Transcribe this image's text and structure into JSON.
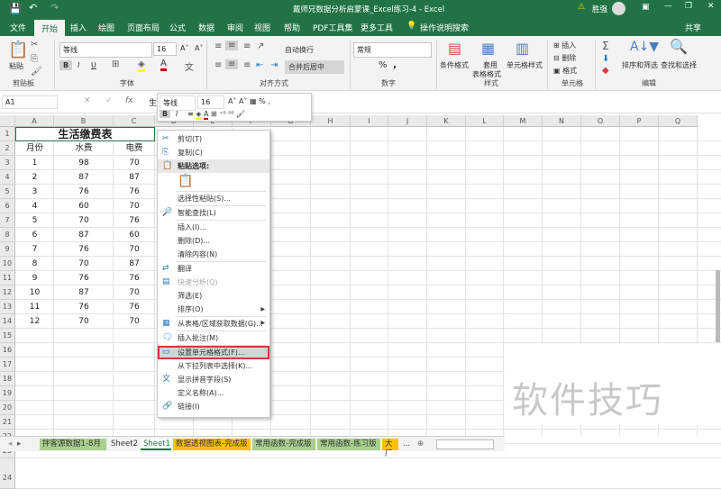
{
  "title": "戴师兄数据分析启蒙课_Excel练习-4  -  Excel",
  "user": "胜强",
  "tabs": [
    "文件",
    "开始",
    "插入",
    "绘图",
    "页面布局",
    "公式",
    "数据",
    "审阅",
    "视图",
    "帮助",
    "PDF工具集",
    "更多工具"
  ],
  "search": "操作说明搜索",
  "share": "共享",
  "ribbon": {
    "paste": "粘贴",
    "clipboard": "剪贴板",
    "font_name": "等线",
    "font_size": "16",
    "font": "字体",
    "wrap": "自动换行",
    "merge": "合并后居中",
    "align": "对齐方式",
    "number_format": "常规",
    "number": "数字",
    "cond": "条件格式",
    "table_fmt1": "套用",
    "table_fmt2": "表格格式",
    "cell_style": "单元格样式",
    "styles": "样式",
    "insert": "插入",
    "delete": "删除",
    "format": "格式",
    "cells": "单元格",
    "sort": "排序和筛选",
    "find": "查找和选择",
    "editing": "编辑",
    "bold": "B",
    "italic": "I",
    "underline": "U",
    "percent": "%",
    "comma": ","
  },
  "namebox": "A1",
  "fx": "fx",
  "formula_value": "生",
  "columns": [
    "A",
    "B",
    "C",
    "D",
    "E",
    "F",
    "G",
    "H",
    "I",
    "J",
    "K",
    "L",
    "M",
    "N",
    "O",
    "P",
    "Q"
  ],
  "sheet": {
    "title": "生活缴费表",
    "headers": [
      "月份",
      "水费",
      "电费"
    ],
    "rows": [
      [
        "1",
        "98",
        "70"
      ],
      [
        "2",
        "87",
        "87"
      ],
      [
        "3",
        "76",
        "76"
      ],
      [
        "4",
        "60",
        "70"
      ],
      [
        "5",
        "70",
        "76"
      ],
      [
        "6",
        "87",
        "60"
      ],
      [
        "7",
        "76",
        "70"
      ],
      [
        "8",
        "70",
        "87"
      ],
      [
        "9",
        "76",
        "76"
      ],
      [
        "10",
        "87",
        "70"
      ],
      [
        "11",
        "76",
        "76"
      ],
      [
        "12",
        "70",
        "70"
      ]
    ]
  },
  "row_numbers": [
    "1",
    "2",
    "3",
    "4",
    "5",
    "6",
    "7",
    "8",
    "9",
    "10",
    "11",
    "12",
    "13",
    "14",
    "15",
    "16",
    "17",
    "18",
    "19",
    "20",
    "21",
    "22",
    "23",
    "24"
  ],
  "mini_toolbar": {
    "font": "等线",
    "size": "16"
  },
  "menu": [
    {
      "label": "剪切(T)",
      "icon": "cut"
    },
    {
      "label": "复制(C)",
      "icon": "copy"
    },
    {
      "label": "粘贴选项:",
      "icon": "paste"
    },
    {
      "label": "选择性粘贴(S)..."
    },
    {
      "label": "智能查找(L)",
      "icon": "search"
    },
    {
      "label": "插入(I)..."
    },
    {
      "label": "删除(D)..."
    },
    {
      "label": "清除内容(N)"
    },
    {
      "label": "翻译",
      "icon": "translate"
    },
    {
      "label": "快速分析(Q)",
      "icon": "quick-analysis"
    },
    {
      "label": "筛选(E)"
    },
    {
      "label": "排序(O)"
    },
    {
      "label": "从表格/区域获取数据(G)...",
      "icon": "table"
    },
    {
      "label": "插入批注(M)",
      "icon": "comment"
    },
    {
      "label": "设置单元格格式(F)...",
      "icon": "format-cells"
    },
    {
      "label": "从下拉列表中选择(K)..."
    },
    {
      "label": "显示拼音字段(S)",
      "icon": "phonetic"
    },
    {
      "label": "定义名称(A)..."
    },
    {
      "label": "链接(I)",
      "icon": "link"
    }
  ],
  "sheet_tabs": [
    {
      "label": "拌客源数据1-8月",
      "color": "#a9d08e"
    },
    {
      "label": "Sheet2",
      "color": ""
    },
    {
      "label": "Sheet1",
      "color": "",
      "active": true
    },
    {
      "label": "数据透视图表-完成版",
      "color": "#ffc000"
    },
    {
      "label": "常用函数-完成版",
      "color": "#a9d08e"
    },
    {
      "label": "常用函数-练习版",
      "color": "#a9d08e"
    },
    {
      "label": "大厂",
      "color": "#ffc000"
    }
  ],
  "more_tabs": "...",
  "watermark": "软件技巧",
  "colors": {
    "excel_green": "#217346",
    "highlight": "#d9363e"
  }
}
